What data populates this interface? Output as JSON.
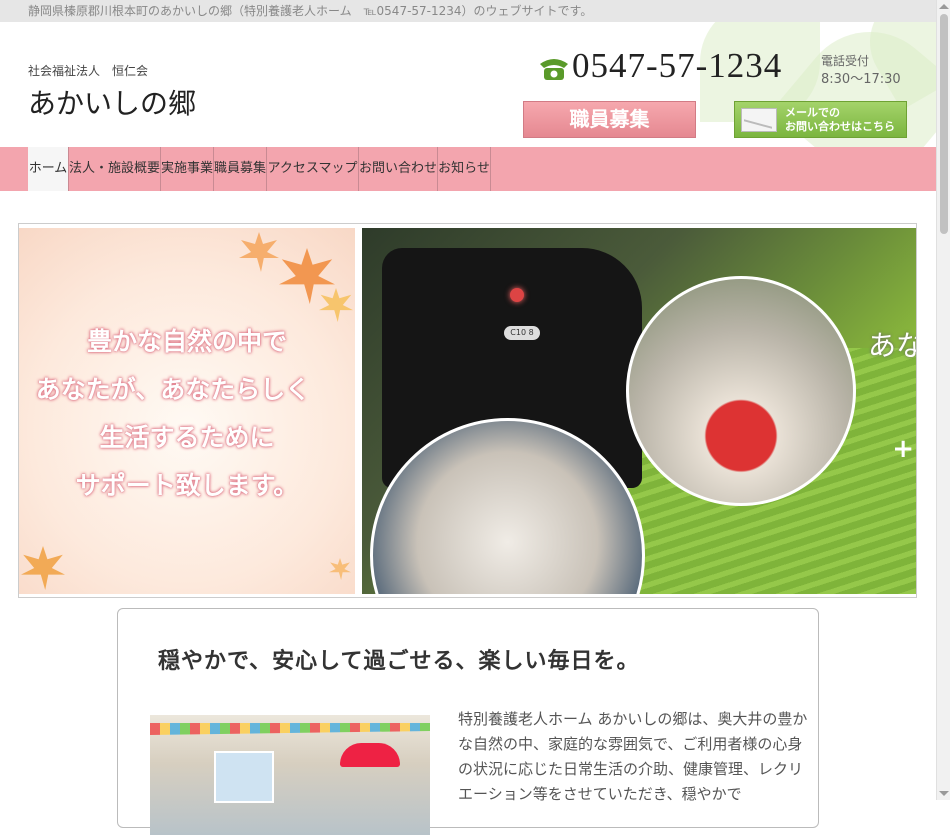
{
  "topbar": {
    "text": "静岡県榛原郡川根本町のあかいしの郷（特別養護老人ホーム　℡0547-57-1234）のウェブサイトです。"
  },
  "header": {
    "corp_name": "社会福祉法人　恒仁会",
    "site_title": "あかいしの郷",
    "phone": "0547-57-1234",
    "phone_hours_label": "電話受付",
    "phone_hours": "8:30〜17:30",
    "recruit_button": "職員募集",
    "mail_button": "メールでの\nお問い合わせはこちら"
  },
  "nav": {
    "items": [
      {
        "label": "ホーム",
        "active": true
      },
      {
        "label": "法人・施設概要"
      },
      {
        "label": "実施事業"
      },
      {
        "label": "職員募集"
      },
      {
        "label": "アクセスマップ"
      },
      {
        "label": "お問い合わせ"
      },
      {
        "label": "お知らせ"
      }
    ]
  },
  "hero": {
    "slogan_lines": [
      "豊かな自然の中で",
      "あなたが、あなたらしく",
      "生活するために",
      "サポート致します。"
    ],
    "train_plate": "C10 8",
    "cut_text": "あな",
    "cut_plus": "+"
  },
  "content": {
    "heading": "穏やかで、安心して過ごせる、楽しい毎日を。",
    "body": "特別養護老人ホーム あかいしの郷は、奥大井の豊かな自然の中、家庭的な雰囲気で、ご利用者様の心身の状況に応じた日常生活の介助、健康管理、レクリエーション等をさせていただき、穏やかで"
  },
  "colors": {
    "nav_bg": "#f3a5ae",
    "recruit": "#e58891",
    "mail": "#7bb53f",
    "phone_icon": "#5a9a2a"
  }
}
